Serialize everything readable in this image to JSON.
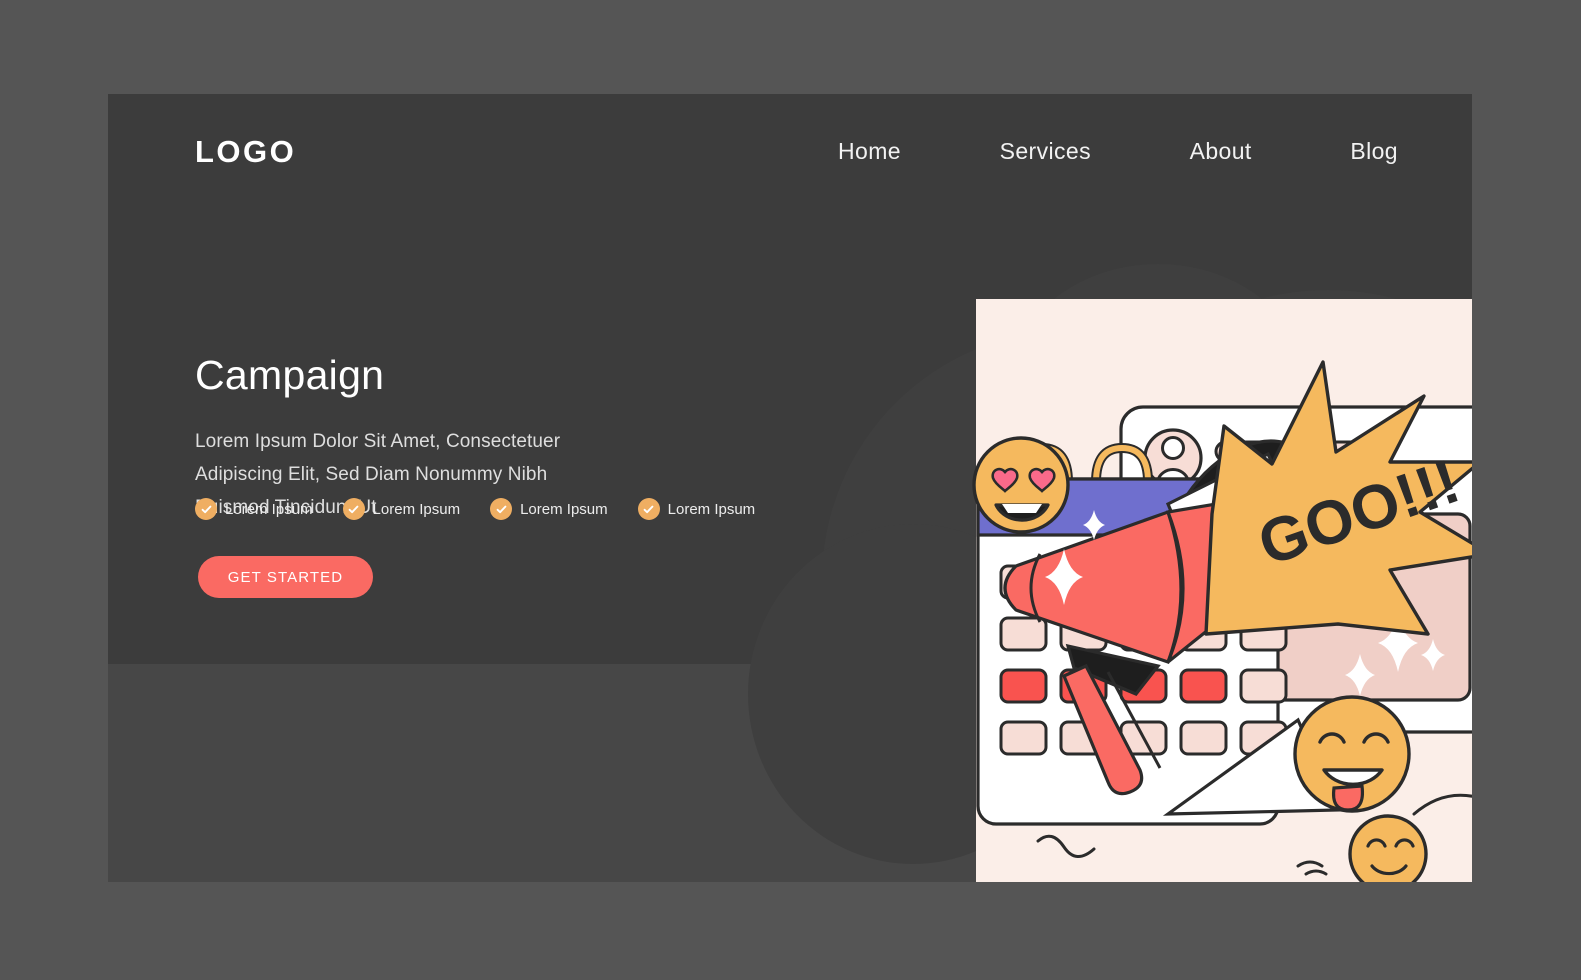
{
  "colors": {
    "page_bg": "#555555",
    "panel_bg": "#474747",
    "panel_upper_bg": "#3c3c3c",
    "accent_red": "#fa6a63",
    "accent_orange": "#efae62",
    "accent_yellow": "#f5b95e",
    "accent_blue": "#6f6fce",
    "text_light": "#ffffff",
    "text_muted": "#dedede",
    "illustration_bg": "#fbeee8",
    "card_white": "#ffffff",
    "pink_panel": "#f0cfc7",
    "outline": "#2b2b2b"
  },
  "header": {
    "logo": "LOGO",
    "nav": [
      {
        "label": "Home"
      },
      {
        "label": "Services"
      },
      {
        "label": "About"
      },
      {
        "label": "Blog"
      }
    ]
  },
  "hero": {
    "title": "Campaign",
    "subtitle": "Lorem Ipsum Dolor Sit Amet, Consectetuer Adipiscing Elit, Sed Diam Nonummy Nibh Euismod Tincidunt Ut",
    "features": [
      {
        "label": "Lorem Ipsum",
        "icon": "check-circle-icon"
      },
      {
        "label": "Lorem Ipsum",
        "icon": "check-circle-icon"
      },
      {
        "label": "Lorem Ipsum",
        "icon": "check-circle-icon"
      },
      {
        "label": "Lorem Ipsum",
        "icon": "check-circle-icon"
      }
    ],
    "cta_label": "GET STARTED"
  },
  "illustration": {
    "name": "campaign-marketing-illustration",
    "speech_text": "GOO!!!",
    "elements": [
      {
        "name": "calendar",
        "header_color": "#6f6fce",
        "ring_color": "#f5b95e",
        "highlighted_days": 4,
        "rows": 4,
        "cols": 5
      },
      {
        "name": "post-card",
        "avatar": "user-avatar-icon",
        "text_bars": 2
      },
      {
        "name": "megaphone",
        "body_color": "#fa6a63",
        "cone_color": "#fa6a63"
      },
      {
        "name": "starburst-speech-bubble",
        "fill": "#f5b95e"
      },
      {
        "name": "emoji-heart-eyes"
      },
      {
        "name": "emoji-tongue-out"
      },
      {
        "name": "emoji-smile"
      },
      {
        "name": "sparkles",
        "count": 5
      }
    ]
  }
}
